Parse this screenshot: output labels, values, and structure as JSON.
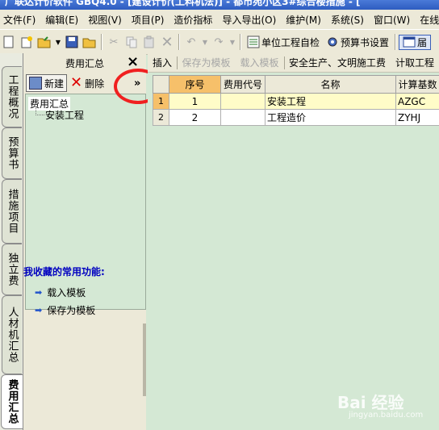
{
  "window": {
    "title": "广联达计价软件 GBQ4.0 - [建设计价(工料机法)] - 都市苑小区3#综合楼措施 - ["
  },
  "menu": [
    "文件(F)",
    "编辑(E)",
    "视图(V)",
    "项目(P)",
    "造价指标",
    "导入导出(O)",
    "维护(M)",
    "系统(S)",
    "窗口(W)",
    "在线"
  ],
  "toolbar": {
    "unit_check": "单位工程自检",
    "budget_settings": "预算书设置",
    "last_label": "届"
  },
  "vtabs": [
    "工程概况",
    "预算书",
    "措施项目",
    "独立费",
    "人材机汇总",
    "费用汇总"
  ],
  "side_panel": {
    "title": "费用汇总",
    "close": "×",
    "new_label": "新建",
    "delete_label": "删除",
    "expand": "»",
    "tree_root": "费用汇总",
    "tree_child": "安装工程",
    "favorites_title": "我收藏的常用功能:",
    "favorites": [
      "载入模板",
      "保存为模板"
    ]
  },
  "main_toolbar": [
    "插入",
    "保存为模板",
    "载入模板",
    "安全生产、文明施工费",
    "计取工程"
  ],
  "table": {
    "headers": [
      "序号",
      "费用代号",
      "名称",
      "计算基数"
    ],
    "rows": [
      {
        "row": "1",
        "seq": "1",
        "code": "",
        "name": "安装工程",
        "base": "AZGC"
      },
      {
        "row": "2",
        "seq": "2",
        "code": "",
        "name": "工程造价",
        "base": "ZYHJ"
      }
    ]
  },
  "watermark": {
    "brand": "Bai 经验",
    "url": "jingyan.baidu.com"
  },
  "colors": {
    "highlight": "#f6c06a",
    "panel_bg": "#d4e8d4",
    "annotation": "#f02020"
  }
}
